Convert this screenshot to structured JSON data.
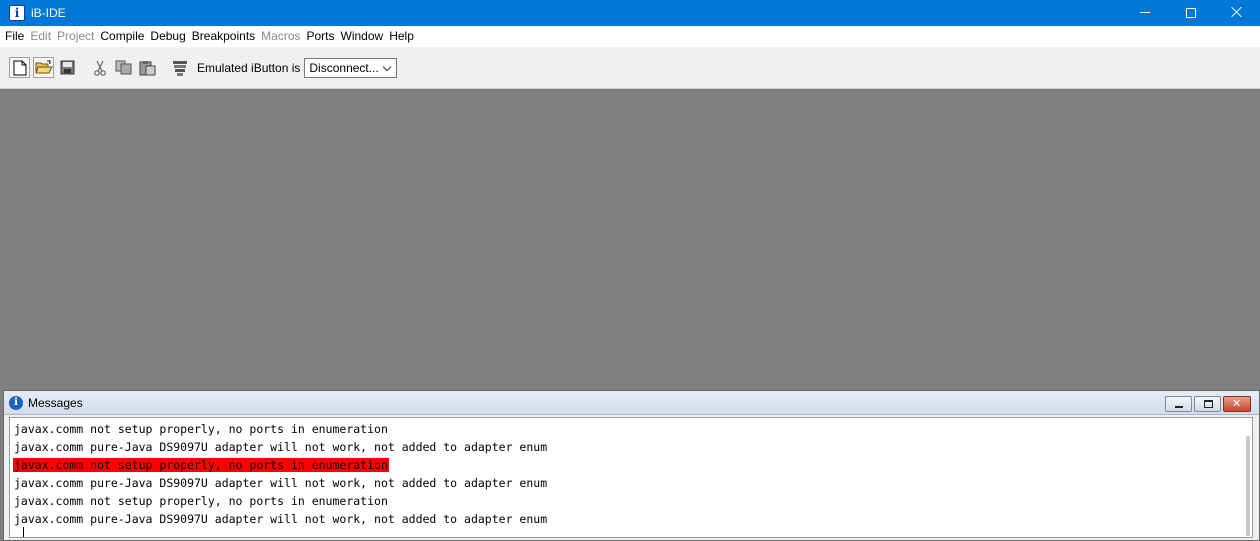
{
  "window": {
    "title": "iB-IDE",
    "app_icon_glyph": "i"
  },
  "menu": [
    {
      "label": "File",
      "enabled": true
    },
    {
      "label": "Edit",
      "enabled": false
    },
    {
      "label": "Project",
      "enabled": false
    },
    {
      "label": "Compile",
      "enabled": true
    },
    {
      "label": "Debug",
      "enabled": true
    },
    {
      "label": "Breakpoints",
      "enabled": true
    },
    {
      "label": "Macros",
      "enabled": false
    },
    {
      "label": "Ports",
      "enabled": true
    },
    {
      "label": "Window",
      "enabled": true
    },
    {
      "label": "Help",
      "enabled": true
    }
  ],
  "toolbar": {
    "emulated_label": "Emulated iButton is",
    "dropdown_value": "Disconnect..."
  },
  "messages": {
    "title": "Messages",
    "info_glyph": "i",
    "close_glyph": "✕",
    "lines": [
      {
        "text": "javax.comm not setup properly, no ports in enumeration",
        "highlight": false
      },
      {
        "text": "javax.comm pure-Java DS9097U adapter will not work, not added to adapter enum",
        "highlight": false
      },
      {
        "text": "javax.comm not setup properly, no ports in enumeration",
        "highlight": true
      },
      {
        "text": "javax.comm pure-Java DS9097U adapter will not work, not added to adapter enum",
        "highlight": false
      },
      {
        "text": "javax.comm not setup properly, no ports in enumeration",
        "highlight": false
      },
      {
        "text": "javax.comm pure-Java DS9097U adapter will not work, not added to adapter enum",
        "highlight": false
      }
    ]
  },
  "colors": {
    "titlebar": "#0078d7",
    "workspace": "#808080",
    "highlight": "#ff0000"
  }
}
